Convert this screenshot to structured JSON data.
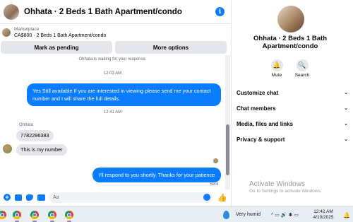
{
  "header": {
    "title": "Ohhata · 2 Beds 1 Bath Apartment/condo",
    "info_icon": "i"
  },
  "marketplace": {
    "label": "Marketplace",
    "listing": "CA$800 · 2 Beds 1 Bath Apartment/condo"
  },
  "actions": {
    "pending": "Mark as pending",
    "more": "More options"
  },
  "messages": {
    "waiting_note": "Ohhata is waiting for your response.",
    "time1": "12:03 AM",
    "out1": "Yes Still available If you are interested in viewing please send me your contact number and I will share the full details.",
    "time2": "12:41 AM",
    "sender": "Ohhata",
    "in1": "7782296383",
    "in2": "This is my number",
    "out2": "I'll respond to you shortly. Thanks for your patience",
    "status": "Sent"
  },
  "composer": {
    "placeholder": "Aa",
    "plus": "+",
    "like": "👍"
  },
  "panel": {
    "title": "Ohhata · 2 Beds 1 Bath Apartment/condo",
    "mute": "Mute",
    "search": "Search",
    "mute_icon": "🔔",
    "search_icon": "🔍",
    "menu": [
      "Customize chat",
      "Chat members",
      "Media, files and links",
      "Privacy & support"
    ],
    "chevron": "⌄",
    "watermark_title": "Activate Windows",
    "watermark_sub": "Go to Settings to activate Windows."
  },
  "taskbar": {
    "weather": "Very humid",
    "tray": "^ ▭ 🔊 ✱ ▭",
    "time": "12:42 AM",
    "date": "4/10/2025",
    "notif": "🔔"
  },
  "colors": {
    "accent": "#0a7cff",
    "bubble_in": "#e4e6eb"
  }
}
